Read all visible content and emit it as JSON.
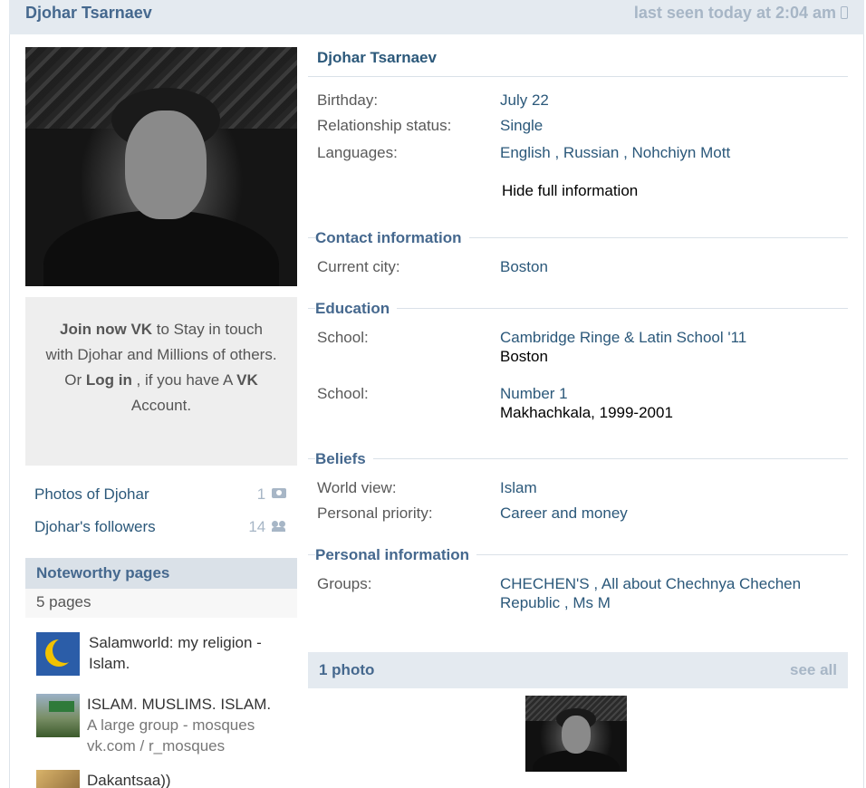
{
  "header": {
    "name": "Djohar Tsarnaev",
    "last_seen": "last seen today at 2:04 am"
  },
  "join": {
    "join_now": "Join now",
    "vk": "VK",
    "line1_rest": " to Stay in touch with Djohar and Millions of others.",
    "or": "Or ",
    "log_in": "Log in",
    "line2_rest": " , if you have A ",
    "vk2": "VK",
    "account": " Account."
  },
  "side_links": [
    {
      "label": "Photos of Djohar",
      "count": "1"
    },
    {
      "label": "Djohar's followers",
      "count": "14"
    }
  ],
  "noteworthy": {
    "title": "Noteworthy pages",
    "count": "5 pages",
    "items": [
      {
        "line1": "Salamworld: my religion -",
        "line2": "Islam.",
        "line3": ""
      },
      {
        "line1": "ISLAM. MUSLIMS. ISLAM.",
        "line2": "A large group - mosques",
        "line3": "vk.com / r_mosques"
      },
      {
        "line1": "Dakantsaa))",
        "line2": "",
        "line3": ""
      }
    ]
  },
  "profile": {
    "name": "Djohar Tsarnaev",
    "basic": [
      {
        "label": "Birthday:",
        "value": "July 22"
      },
      {
        "label": "Relationship status:",
        "value": "Single"
      },
      {
        "label": "Languages:",
        "value": "English , Russian , Nohchiyn Mott"
      }
    ],
    "hide_link": "Hide full information",
    "contact": {
      "title": "Contact information",
      "label": "Current city:",
      "value": "Boston"
    },
    "education": {
      "title": "Education",
      "schools": [
        {
          "label": "School:",
          "name": "Cambridge Ringe & Latin School '11",
          "detail": "Boston"
        },
        {
          "label": "School:",
          "name": "Number 1",
          "detail": "Makhachkala, 1999-2001"
        }
      ]
    },
    "beliefs": {
      "title": "Beliefs",
      "rows": [
        {
          "label": "World view:",
          "value": "Islam"
        },
        {
          "label": "Personal priority:",
          "value": "Career and money"
        }
      ]
    },
    "personal": {
      "title": "Personal information",
      "label": "Groups:",
      "line1": "CHECHEN'S , All about Chechnya Chechen",
      "line2": "Republic , Ms M"
    }
  },
  "photos": {
    "title": "1 photo",
    "see_all": "see all"
  }
}
